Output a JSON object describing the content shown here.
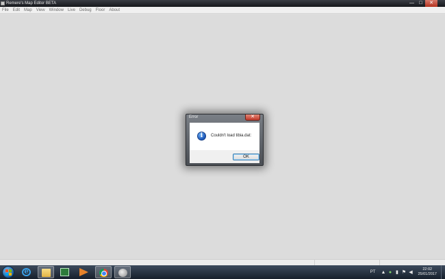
{
  "window": {
    "title": "Remere's Map Editor BETA",
    "controls": {
      "minimize": "—",
      "maximize": "□",
      "close": "✕"
    }
  },
  "menubar": {
    "items": [
      "File",
      "Edit",
      "Map",
      "View",
      "Window",
      "Live",
      "Debug",
      "Floor",
      "About"
    ]
  },
  "dialog": {
    "title": "Error",
    "close_glyph": "✕",
    "icon": "info-icon",
    "message": "Couldn't load tibia.dat:",
    "ok_label": "OK"
  },
  "taskbar": {
    "apps": [
      "internet-explorer-icon",
      "folder-icon",
      "terminal-icon",
      "media-player-icon",
      "chrome-icon",
      "map-editor-icon"
    ],
    "active_app": "folder-icon",
    "tray": {
      "language": "PT",
      "time": "22:02",
      "date": "25/01/2017"
    }
  },
  "colors": {
    "canvas": "#dcdcdc",
    "taskbar": "#17202c",
    "dialog_close": "#c0392b",
    "info_icon": "#1c56b8"
  }
}
